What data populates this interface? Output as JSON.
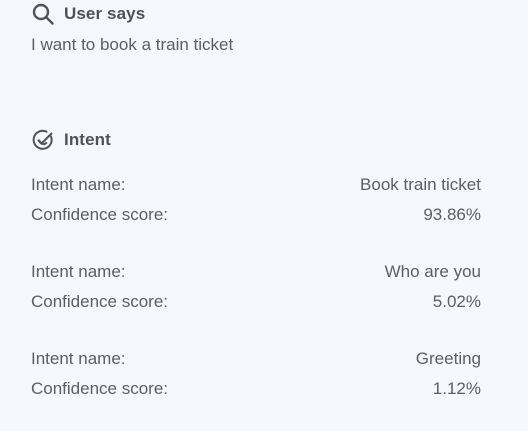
{
  "user_says": {
    "title": "User says",
    "icon": "search-icon",
    "text": "I want to book a train ticket"
  },
  "intent": {
    "title": "Intent",
    "icon": "check-badge-icon",
    "name_label": "Intent name:",
    "score_label": "Confidence score:",
    "items": [
      {
        "name": "Book train ticket",
        "score": "93.86%"
      },
      {
        "name": "Who are you",
        "score": "5.02%"
      },
      {
        "name": "Greeting",
        "score": "1.12%"
      }
    ]
  },
  "colors": {
    "background": "#f5f9fd",
    "text": "#5a5f66",
    "heading": "#4e535a"
  }
}
